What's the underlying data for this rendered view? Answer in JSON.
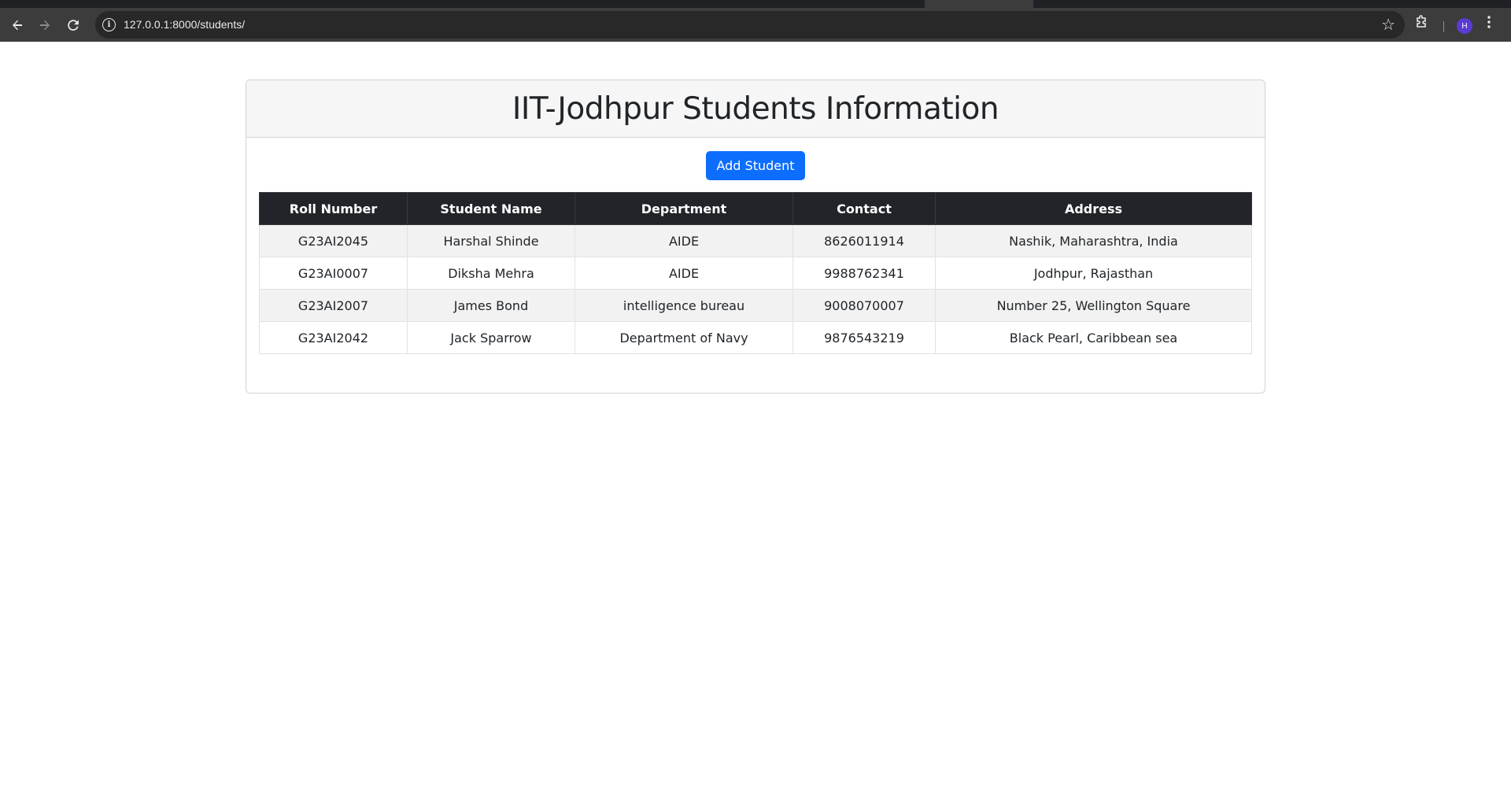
{
  "browser": {
    "url": "127.0.0.1:8000/students/",
    "avatar_initial": "H",
    "icons": {
      "back": "arrow-left-icon",
      "forward": "arrow-right-icon",
      "reload": "reload-icon",
      "info": "info-icon",
      "bookmark": "star-icon",
      "extensions": "puzzle-icon",
      "menu": "kebab-menu-icon"
    }
  },
  "page": {
    "title": "IIT-Jodhpur Students Information",
    "add_button_label": "Add Student",
    "accent_color": "#0d6efd",
    "table": {
      "headers": [
        "Roll Number",
        "Student Name",
        "Department",
        "Contact",
        "Address"
      ],
      "rows": [
        [
          "G23AI2045",
          "Harshal Shinde",
          "AIDE",
          "8626011914",
          "Nashik, Maharashtra, India"
        ],
        [
          "G23AI0007",
          "Diksha Mehra",
          "AIDE",
          "9988762341",
          "Jodhpur, Rajasthan"
        ],
        [
          "G23AI2007",
          "James Bond",
          "intelligence bureau",
          "9008070007",
          "Number 25, Wellington Square"
        ],
        [
          "G23AI2042",
          "Jack Sparrow",
          "Department of Navy",
          "9876543219",
          "Black Pearl, Caribbean sea"
        ]
      ]
    }
  }
}
